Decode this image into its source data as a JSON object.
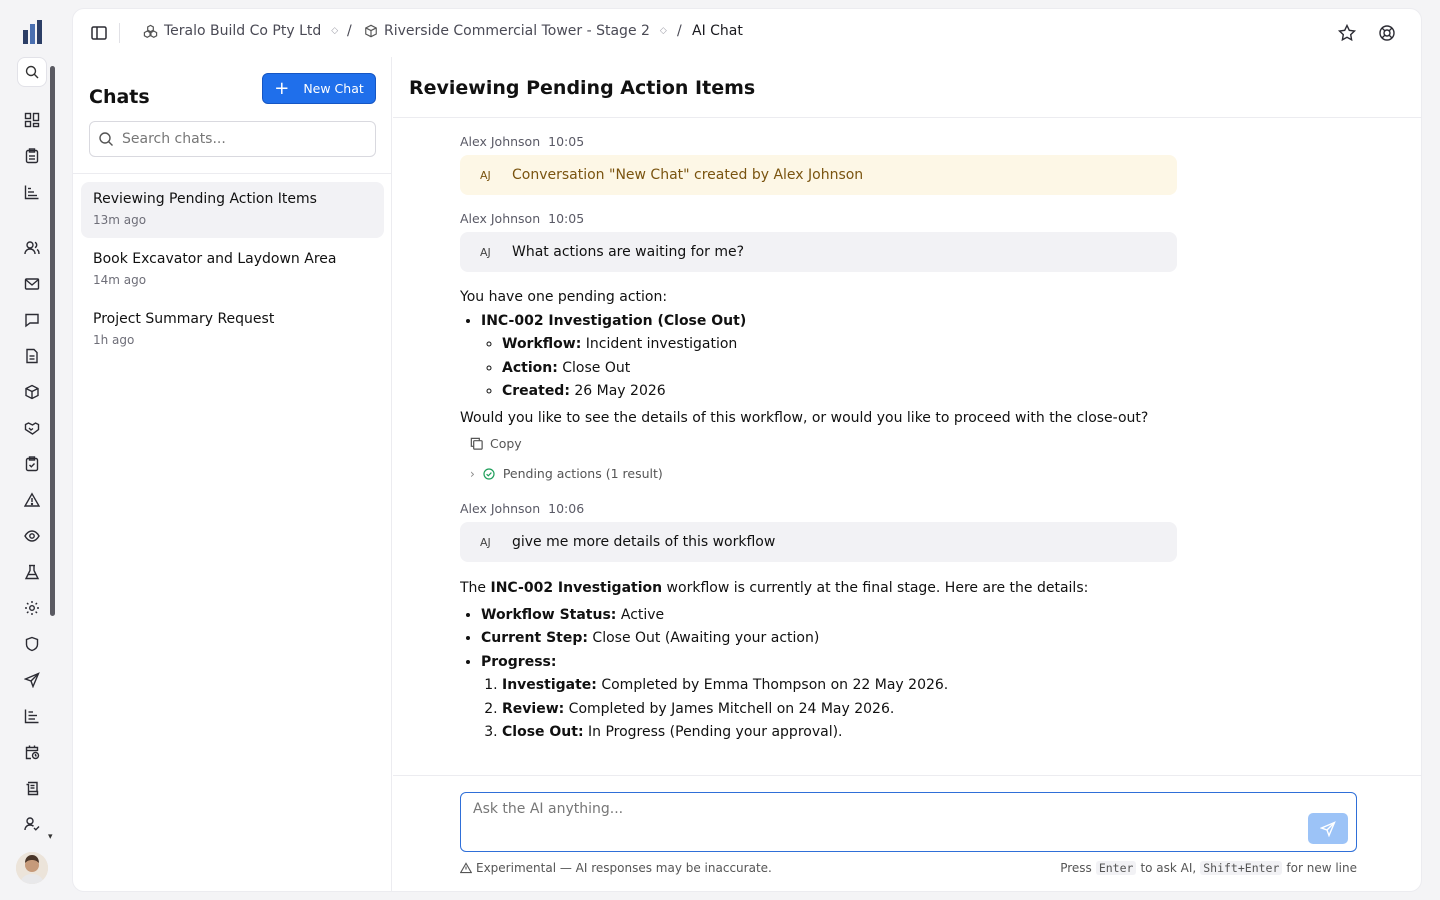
{
  "breadcrumb": {
    "company": "Teralo Build Co Pty Ltd",
    "project": "Riverside Commercial Tower - Stage 2",
    "page": "AI Chat",
    "separator": "/"
  },
  "chats_panel": {
    "title": "Chats",
    "new_chat_label": "New Chat",
    "search_placeholder": "Search chats...",
    "items": [
      {
        "title": "Reviewing Pending Action Items",
        "time": "13m ago",
        "active": true
      },
      {
        "title": "Book Excavator and Laydown Area",
        "time": "14m ago",
        "active": false
      },
      {
        "title": "Project Summary Request",
        "time": "1h ago",
        "active": false
      }
    ]
  },
  "conversation": {
    "title": "Reviewing Pending Action Items",
    "initials": "AJ",
    "messages": [
      {
        "author": "Alex Johnson",
        "time": "10:05",
        "text": "Conversation \"New Chat\" created by Alex Johnson"
      },
      {
        "author": "Alex Johnson",
        "time": "10:05",
        "text": "What actions are waiting for me?"
      },
      {
        "author": "Alex Johnson",
        "time": "10:06",
        "text": "give me more details of this workflow"
      }
    ],
    "reply1": {
      "intro": "You have one pending action:",
      "item_title": "INC-002 Investigation (Close Out)",
      "details": [
        {
          "label": "Workflow:",
          "value": " Incident investigation"
        },
        {
          "label": "Action:",
          "value": " Close Out"
        },
        {
          "label": "Created:",
          "value": " 26 May 2026"
        }
      ],
      "question": "Would you like to see the details of this workflow, or would you like to proceed with the close-out?",
      "copy_label": "Copy",
      "tool_result": "Pending actions (1 result)"
    },
    "reply2": {
      "intro_pre": "The ",
      "intro_bold": "INC-002 Investigation",
      "intro_post": " workflow is currently at the final stage. Here are the details:",
      "bullets": [
        {
          "label": "Workflow Status:",
          "value": " Active"
        },
        {
          "label": "Current Step:",
          "value": " Close Out (Awaiting your action)"
        },
        {
          "label": "Progress:",
          "value": ""
        }
      ],
      "steps": [
        {
          "label": "Investigate:",
          "value": " Completed by Emma Thompson on 22 May 2026."
        },
        {
          "label": "Review:",
          "value": " Completed by James Mitchell on 24 May 2026."
        },
        {
          "label": "Close Out:",
          "value": " In Progress (Pending your approval)."
        }
      ]
    }
  },
  "composer": {
    "placeholder": "Ask the AI anything...",
    "disclaimer": "Experimental — AI responses may be inaccurate.",
    "hint_press": "Press",
    "hint_enter": "Enter",
    "hint_to_ask": "to ask AI,",
    "hint_shift_enter": "Shift+Enter",
    "hint_new_line": "for new line"
  },
  "icons": {
    "rail": [
      "app-logo",
      "search-icon",
      "dashboard-icon",
      "clipboard-icon",
      "chart-icon",
      "users-icon",
      "mail-icon",
      "chat-icon",
      "document-icon",
      "box-icon",
      "handshake-icon",
      "checklist-icon",
      "warning-icon",
      "eye-icon",
      "flask-icon",
      "settings-icon",
      "shield-icon",
      "send-icon",
      "bar-chart-icon",
      "calendar-clock-icon",
      "scroll-icon",
      "user-check-icon"
    ]
  },
  "colors": {
    "primary": "#1f6feb",
    "system_bubble": "#fdf7e6",
    "user_bubble": "#f2f2f5",
    "send_button": "#9cc3f7",
    "success": "#1e9e5a"
  }
}
